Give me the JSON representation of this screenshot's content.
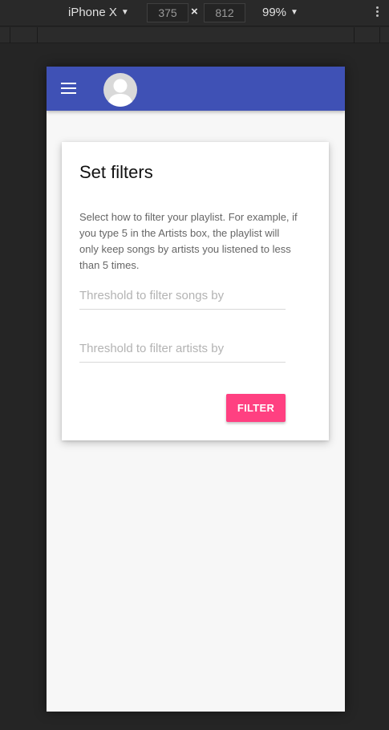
{
  "devtools": {
    "device": "iPhone X",
    "width": "375",
    "height": "812",
    "dimension_separator": "×",
    "zoom": "99%"
  },
  "app": {
    "header_color": "#3f51b5",
    "menu_icon": "hamburger-menu-icon",
    "avatar_icon": "user-avatar-icon"
  },
  "card": {
    "title": "Set filters",
    "description": "Select how to filter your playlist. For example, if you type 5 in the Artists box, the playlist will only keep songs by artists you listened to less than 5 times.",
    "songs_placeholder": "Threshold to filter songs by",
    "artists_placeholder": "Threshold to filter artists by",
    "filter_button": "FILTER",
    "accent_color": "#ff4081"
  }
}
